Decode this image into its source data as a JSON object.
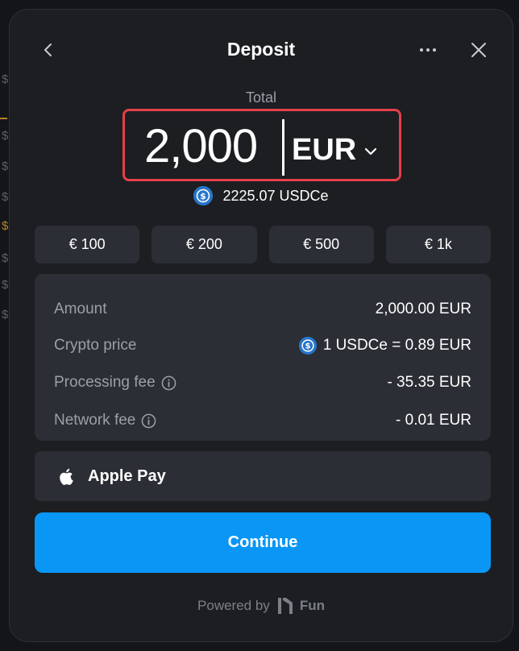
{
  "header": {
    "title": "Deposit"
  },
  "amount": {
    "label": "Total",
    "value": "2,000",
    "currency": "EUR"
  },
  "conversion": {
    "text": "2225.07 USDCe"
  },
  "presets": [
    {
      "label": "€ 100"
    },
    {
      "label": "€ 200"
    },
    {
      "label": "€ 500"
    },
    {
      "label": "€ 1k"
    }
  ],
  "details": {
    "amount": {
      "label": "Amount",
      "value": "2,000.00 EUR"
    },
    "crypto_price": {
      "label": "Crypto price",
      "value": "1 USDCe = 0.89 EUR"
    },
    "processing_fee": {
      "label": "Processing fee",
      "value": "- 35.35 EUR"
    },
    "network_fee": {
      "label": "Network fee",
      "value": "- 0.01 EUR"
    }
  },
  "payment_method": {
    "label": "Apple Pay"
  },
  "continue_label": "Continue",
  "footer": {
    "powered_by": "Powered by",
    "brand": "Fun"
  },
  "colors": {
    "accent": "#0a96f5",
    "highlight_border": "#e5404a",
    "usdc": "#2775ca"
  },
  "background": {
    "dollar_glyph": "$"
  }
}
